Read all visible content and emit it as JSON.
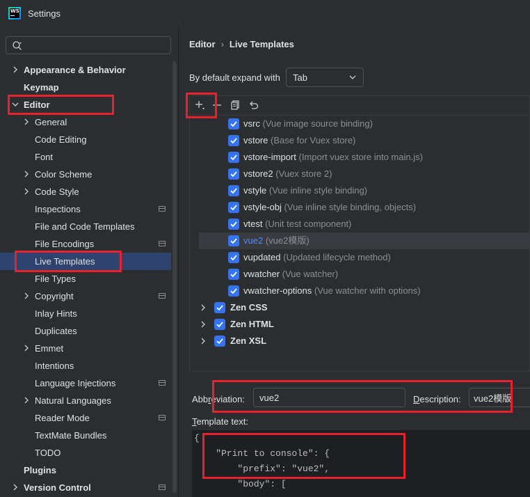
{
  "window": {
    "title": "Settings",
    "logo_text": "WS"
  },
  "search": {
    "placeholder": "",
    "value": ""
  },
  "sidebar": {
    "items": [
      {
        "label": "Appearance & Behavior",
        "bold": true,
        "chevron": "right",
        "level": 0
      },
      {
        "label": "Keymap",
        "bold": true,
        "chevron": "",
        "level": 0
      },
      {
        "label": "Editor",
        "bold": true,
        "chevron": "down",
        "level": 0
      },
      {
        "label": "General",
        "chevron": "right",
        "level": 1
      },
      {
        "label": "Code Editing",
        "level": 1
      },
      {
        "label": "Font",
        "level": 1
      },
      {
        "label": "Color Scheme",
        "chevron": "right",
        "level": 1
      },
      {
        "label": "Code Style",
        "chevron": "right",
        "level": 1
      },
      {
        "label": "Inspections",
        "level": 1,
        "project": true
      },
      {
        "label": "File and Code Templates",
        "level": 1
      },
      {
        "label": "File Encodings",
        "level": 1,
        "project": true
      },
      {
        "label": "Live Templates",
        "level": 1,
        "selected": true
      },
      {
        "label": "File Types",
        "level": 1
      },
      {
        "label": "Copyright",
        "chevron": "right",
        "level": 1,
        "project": true
      },
      {
        "label": "Inlay Hints",
        "level": 1
      },
      {
        "label": "Duplicates",
        "level": 1
      },
      {
        "label": "Emmet",
        "chevron": "right",
        "level": 1
      },
      {
        "label": "Intentions",
        "level": 1
      },
      {
        "label": "Language Injections",
        "level": 1,
        "project": true
      },
      {
        "label": "Natural Languages",
        "chevron": "right",
        "level": 1
      },
      {
        "label": "Reader Mode",
        "level": 1,
        "project": true
      },
      {
        "label": "TextMate Bundles",
        "level": 1
      },
      {
        "label": "TODO",
        "level": 1
      },
      {
        "label": "Plugins",
        "bold": true,
        "level": 0
      },
      {
        "label": "Version Control",
        "bold": true,
        "chevron": "right",
        "level": 0,
        "project": true
      }
    ]
  },
  "breadcrumb": {
    "parent": "Editor",
    "current": "Live Templates"
  },
  "expand": {
    "label": "By default expand with",
    "value": "Tab"
  },
  "toolbar": {
    "icons": [
      "add-icon",
      "remove-icon",
      "copy-icon",
      "restore-icon"
    ]
  },
  "templates": [
    {
      "name": "vsrc",
      "desc": "(Vue image source binding)"
    },
    {
      "name": "vstore",
      "desc": "(Base for Vuex store)"
    },
    {
      "name": "vstore-import",
      "desc": "(Import vuex store into main.js)"
    },
    {
      "name": "vstore2",
      "desc": "(Vuex store 2)"
    },
    {
      "name": "vstyle",
      "desc": "(Vue inline style binding)"
    },
    {
      "name": "vstyle-obj",
      "desc": "(Vue inline style binding, objects)"
    },
    {
      "name": "vtest",
      "desc": "(Unit test component)"
    },
    {
      "name": "vue2",
      "desc": "(vue2模版)",
      "selected": true
    },
    {
      "name": "vupdated",
      "desc": "(Updated lifecycle method)"
    },
    {
      "name": "vwatcher",
      "desc": "(Vue watcher)"
    },
    {
      "name": "vwatcher-options",
      "desc": "(Vue watcher with options)"
    }
  ],
  "groups": [
    {
      "name": "Zen CSS"
    },
    {
      "name": "Zen HTML"
    },
    {
      "name": "Zen XSL"
    }
  ],
  "abbreviation": {
    "label": "Abbreviation:",
    "value": "vue2"
  },
  "description": {
    "label": "Description:",
    "value": "vue2模版"
  },
  "template_text": {
    "label": "Template text:",
    "lines": [
      "{",
      "    \"Print to console\": {",
      "        \"prefix\": \"vue2\",",
      "        \"body\": ["
    ]
  },
  "colors": {
    "accent": "#3574f0",
    "selection": "#2e436e",
    "highlight_box": "#e8222d"
  }
}
